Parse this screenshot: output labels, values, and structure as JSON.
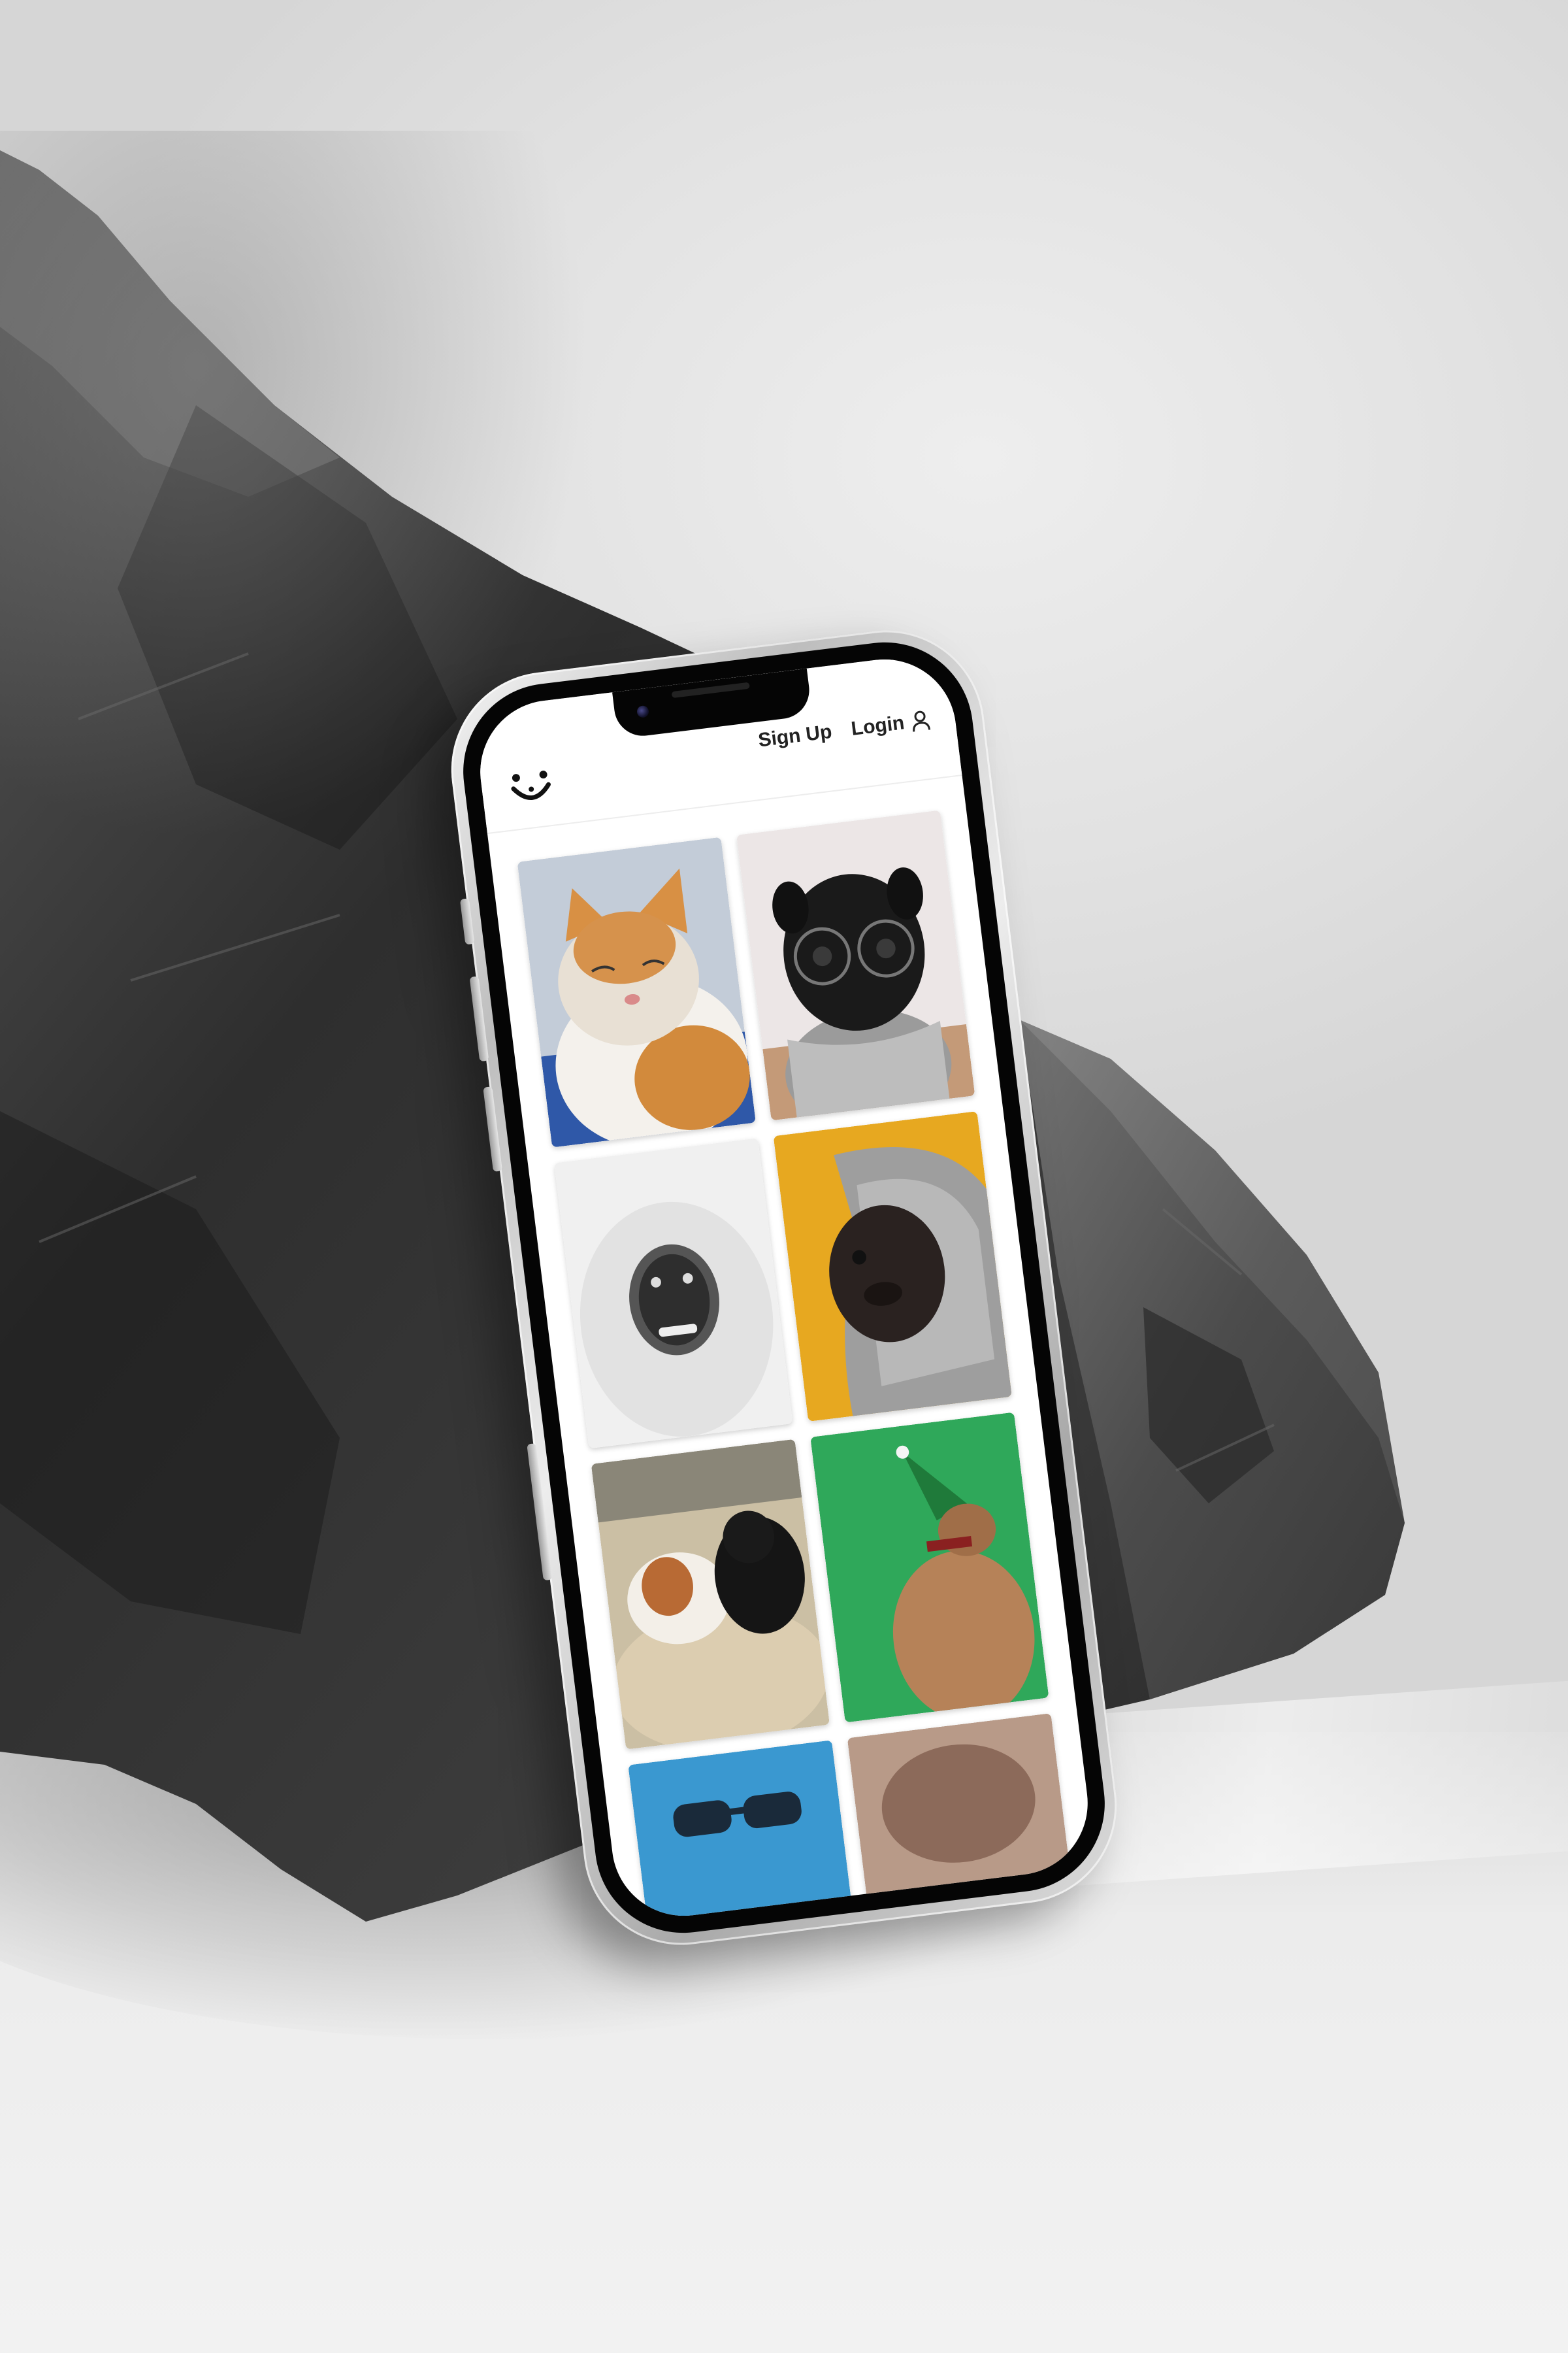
{
  "nav": {
    "signup_label": "Sign Up",
    "login_label": "Login",
    "logo_icon": "smiley-face-icon",
    "user_icon": "user-icon"
  },
  "gallery": {
    "tiles": [
      {
        "subject": "ginger-white-cat",
        "background": "#9fb4d0"
      },
      {
        "subject": "pug-with-glasses-and-scarf",
        "background": "#e9e4e4"
      },
      {
        "subject": "white-monkey",
        "background": "#e8e8e8"
      },
      {
        "subject": "pug-in-grey-hoodie",
        "background": "#e7a820"
      },
      {
        "subject": "two-dogs-on-couch",
        "background": "#c9b79a"
      },
      {
        "subject": "dog-with-party-hat",
        "background": "#2fa85a"
      },
      {
        "subject": "sunglasses",
        "background": "#3a98d0"
      },
      {
        "subject": "blurred-animal",
        "background": "#b89a88"
      }
    ]
  },
  "colors": {
    "accent_text": "#222222",
    "screen_bg": "#ffffff",
    "rock": "#3a3a3a"
  }
}
